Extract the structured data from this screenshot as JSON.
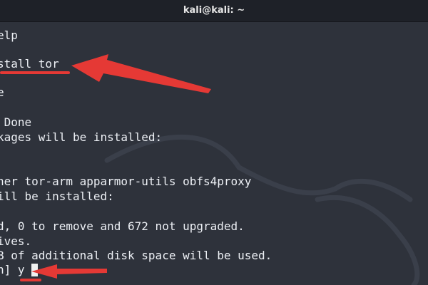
{
  "window": {
    "title": "kali@kali: ~"
  },
  "terminal": {
    "lines": [
      "elp",
      "stall tor",
      "e",
      " Done",
      "kages will be installed:",
      "her tor-arm apparmor-utils obfs4proxy",
      "ill be installed:",
      "d, 0 to remove and 672 not upgraded.",
      "ives.",
      "B of additional disk space will be used.",
      "n] y"
    ]
  },
  "colors": {
    "background": "#2e323b",
    "titlebar": "#1e2128",
    "text": "#eceff4",
    "annotation": "#e53935"
  },
  "icons": {
    "annotation_arrows": "red-arrow-icon",
    "watermark": "kali-dragon-icon"
  }
}
